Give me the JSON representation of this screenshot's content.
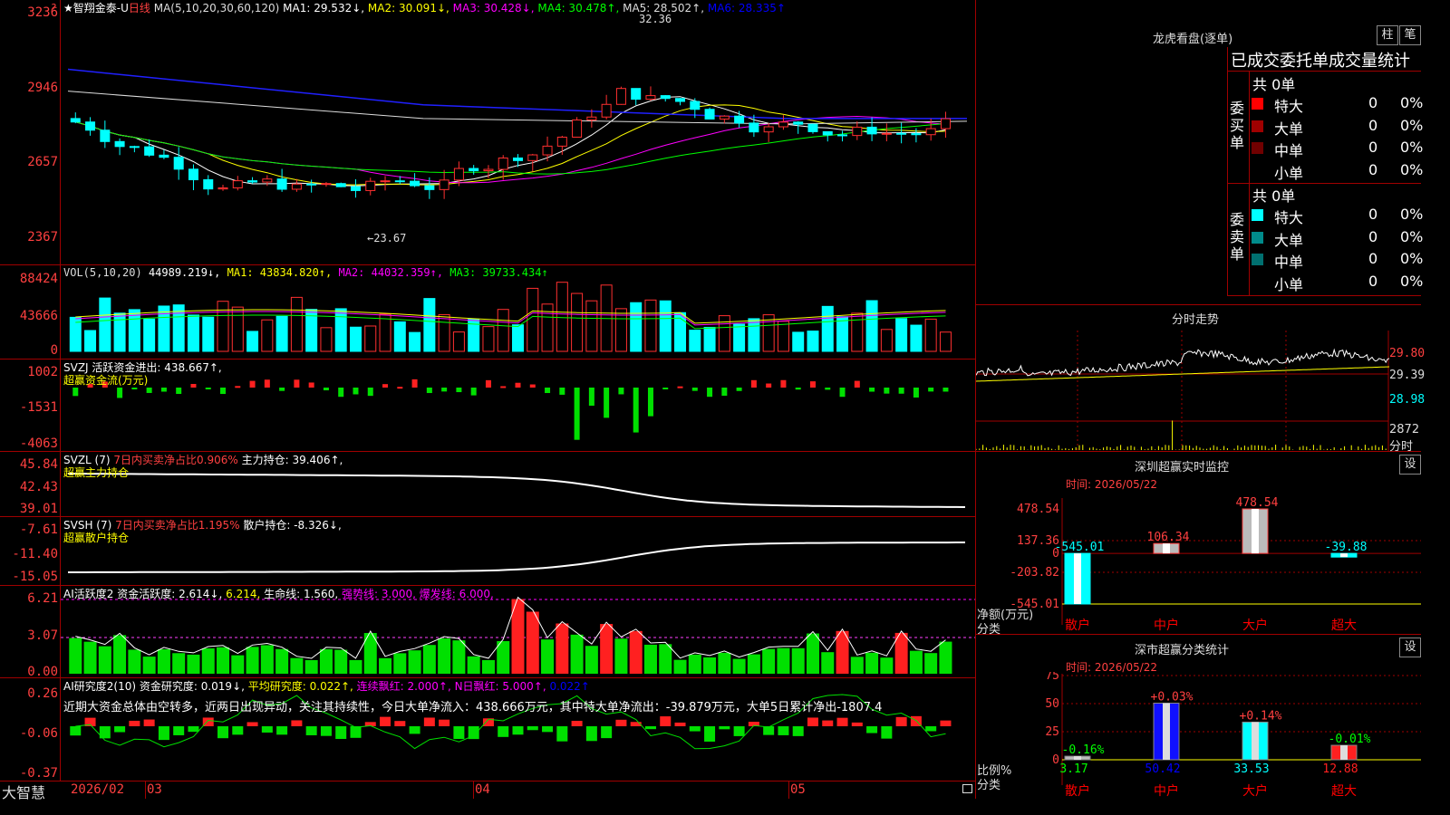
{
  "app": {
    "brand": "大智慧"
  },
  "main_chart": {
    "header": {
      "name": "★智翔金泰-U",
      "period": "日线",
      "ma_params": "MA(5,10,20,30,60,120)",
      "ma": [
        {
          "label": "MA1:",
          "value": "29.532↓,",
          "color": "#ffffff"
        },
        {
          "label": "MA2:",
          "value": "30.091↓,",
          "color": "#ffff00"
        },
        {
          "label": "MA3:",
          "value": "30.428↓,",
          "color": "#ff00ff"
        },
        {
          "label": "MA4:",
          "value": "30.478↑,",
          "color": "#00ff00"
        },
        {
          "label": "MA5:",
          "value": "28.502↑,",
          "color": "#dddddd"
        },
        {
          "label": "MA6:",
          "value": "28.335↑",
          "color": "#0000ff"
        }
      ]
    },
    "y_ticks": [
      "3236",
      "2946",
      "2657",
      "2367"
    ],
    "high_label": "32.36",
    "low_label": "←23.67",
    "top_marker": "?"
  },
  "vol_panel": {
    "header": "VOL(5,10,20)",
    "values": [
      {
        "t": "44989.219↓,",
        "c": "#ffffff"
      },
      {
        "t": "MA1: 43834.820↑,",
        "c": "#ffff00"
      },
      {
        "t": "MA2: 44032.359↑,",
        "c": "#ff00ff"
      },
      {
        "t": "MA3: 39733.434↑",
        "c": "#00ff00"
      }
    ],
    "y_ticks": [
      "88424",
      "43666",
      "0"
    ]
  },
  "svzj_panel": {
    "header": "SVZJ  活跃资金进出: 438.667↑,",
    "subtitle": "超赢资金流(万元)",
    "y_ticks": [
      "1002",
      "-1531",
      "-4063"
    ]
  },
  "svzl_panel": {
    "header": "SVZL (7)",
    "pct": "7日内买卖净占比0.906%",
    "hold": "主力持仓: 39.406↑,",
    "subtitle": "超赢主力持仓",
    "y_ticks": [
      "45.84",
      "42.43",
      "39.01"
    ]
  },
  "svsh_panel": {
    "header": "SVSH (7)",
    "pct": "7日内买卖净占比1.195%",
    "hold": "散户持仓: -8.326↓,",
    "subtitle": "超赢散户持仓",
    "y_ticks": [
      "-7.61",
      "-11.40",
      "-15.05"
    ]
  },
  "ai1_panel": {
    "header": "AI活跃度2",
    "items": [
      {
        "t": "资金活跃度: 2.614↓,",
        "c": "#ffffff"
      },
      {
        "t": "6.214,",
        "c": "#ffff00"
      },
      {
        "t": "生命线: 1.560,",
        "c": "#ffffff"
      },
      {
        "t": "强势线: 3.000,",
        "c": "#ff00ff"
      },
      {
        "t": "爆发线: 6.000,",
        "c": "#ff00ff"
      }
    ],
    "y_ticks": [
      "6.21",
      "3.07",
      "0.00"
    ]
  },
  "ai2_panel": {
    "header": "AI研究度2(10)",
    "items": [
      {
        "t": "资金研究度: 0.019↓,",
        "c": "#ffffff"
      },
      {
        "t": "平均研究度: 0.022↑,",
        "c": "#ffff00"
      },
      {
        "t": "连续飘红: 2.000↑,",
        "c": "#ff00ff"
      },
      {
        "t": "N日飘红: 5.000↑,",
        "c": "#ff00ff"
      },
      {
        "t": "0.022↑",
        "c": "#0000ff"
      }
    ],
    "comment": "近期大资金总体由空转多，近两日出现异动，关注其持续性，今日大单净流入：438.666万元，其中特大单净流出：-39.879万元，大单5日累计净出-1807.4",
    "y_ticks": [
      "0.26",
      "-0.06",
      "-0.37"
    ]
  },
  "x_axis": {
    "labels": [
      "2026/02",
      "03",
      "04",
      "05"
    ]
  },
  "dragon": {
    "title": "龙虎看盘(逐单)",
    "buttons": [
      "柱",
      "笔"
    ],
    "headline": "已成交委托单成交量统计",
    "buy": {
      "label": "委买单",
      "total": "共 0单",
      "rows": [
        {
          "name": "特大",
          "v": "0",
          "p": "0%",
          "color": "#ff0000"
        },
        {
          "name": "大单",
          "v": "0",
          "p": "0%",
          "color": "#a00000"
        },
        {
          "name": "中单",
          "v": "0",
          "p": "0%",
          "color": "#700000"
        },
        {
          "name": "小单",
          "v": "0",
          "p": "0%",
          "color": ""
        }
      ]
    },
    "sell": {
      "label": "委卖单",
      "total": "共 0单",
      "rows": [
        {
          "name": "特大",
          "v": "0",
          "p": "0%",
          "color": "#00ffff"
        },
        {
          "name": "大单",
          "v": "0",
          "p": "0%",
          "color": "#008b8b"
        },
        {
          "name": "中单",
          "v": "0",
          "p": "0%",
          "color": "#007070"
        },
        {
          "name": "小单",
          "v": "0",
          "p": "0%",
          "color": ""
        }
      ]
    }
  },
  "intraday": {
    "title": "分时走势",
    "y_ticks": [
      "29.80",
      "29.39",
      "28.98"
    ],
    "vol_tick": "2872",
    "vol_label": "分时"
  },
  "sz_monitor": {
    "title": "深圳超赢实时监控",
    "set": "设",
    "time": "时间: 2026/05/22",
    "y_ticks": [
      "478.54",
      "137.36",
      "0",
      "-203.82",
      "-545.01"
    ],
    "ylabel1": "净额(万元)",
    "ylabel2": "分类",
    "bars": [
      {
        "cat": "散户",
        "v": -545.01,
        "label": "-545.01"
      },
      {
        "cat": "中户",
        "v": 106.34,
        "label": "106.34"
      },
      {
        "cat": "大户",
        "v": 478.54,
        "label": "478.54"
      },
      {
        "cat": "超大",
        "v": -39.88,
        "label": "-39.88"
      }
    ]
  },
  "sz_class": {
    "title": "深市超赢分类统计",
    "set": "设",
    "time": "时间: 2026/05/22",
    "y_ticks": [
      "75",
      "50",
      "25",
      "0"
    ],
    "ylabel1": "比例%",
    "ylabel2": "分类",
    "bars": [
      {
        "cat": "散户",
        "v": 3.17,
        "label": "3.17",
        "delta": "-0.16%"
      },
      {
        "cat": "中户",
        "v": 50.42,
        "label": "50.42",
        "delta": "+0.03%"
      },
      {
        "cat": "大户",
        "v": 33.53,
        "label": "33.53",
        "delta": "+0.14%"
      },
      {
        "cat": "超大",
        "v": 12.88,
        "label": "12.88",
        "delta": "-0.01%"
      }
    ]
  }
}
